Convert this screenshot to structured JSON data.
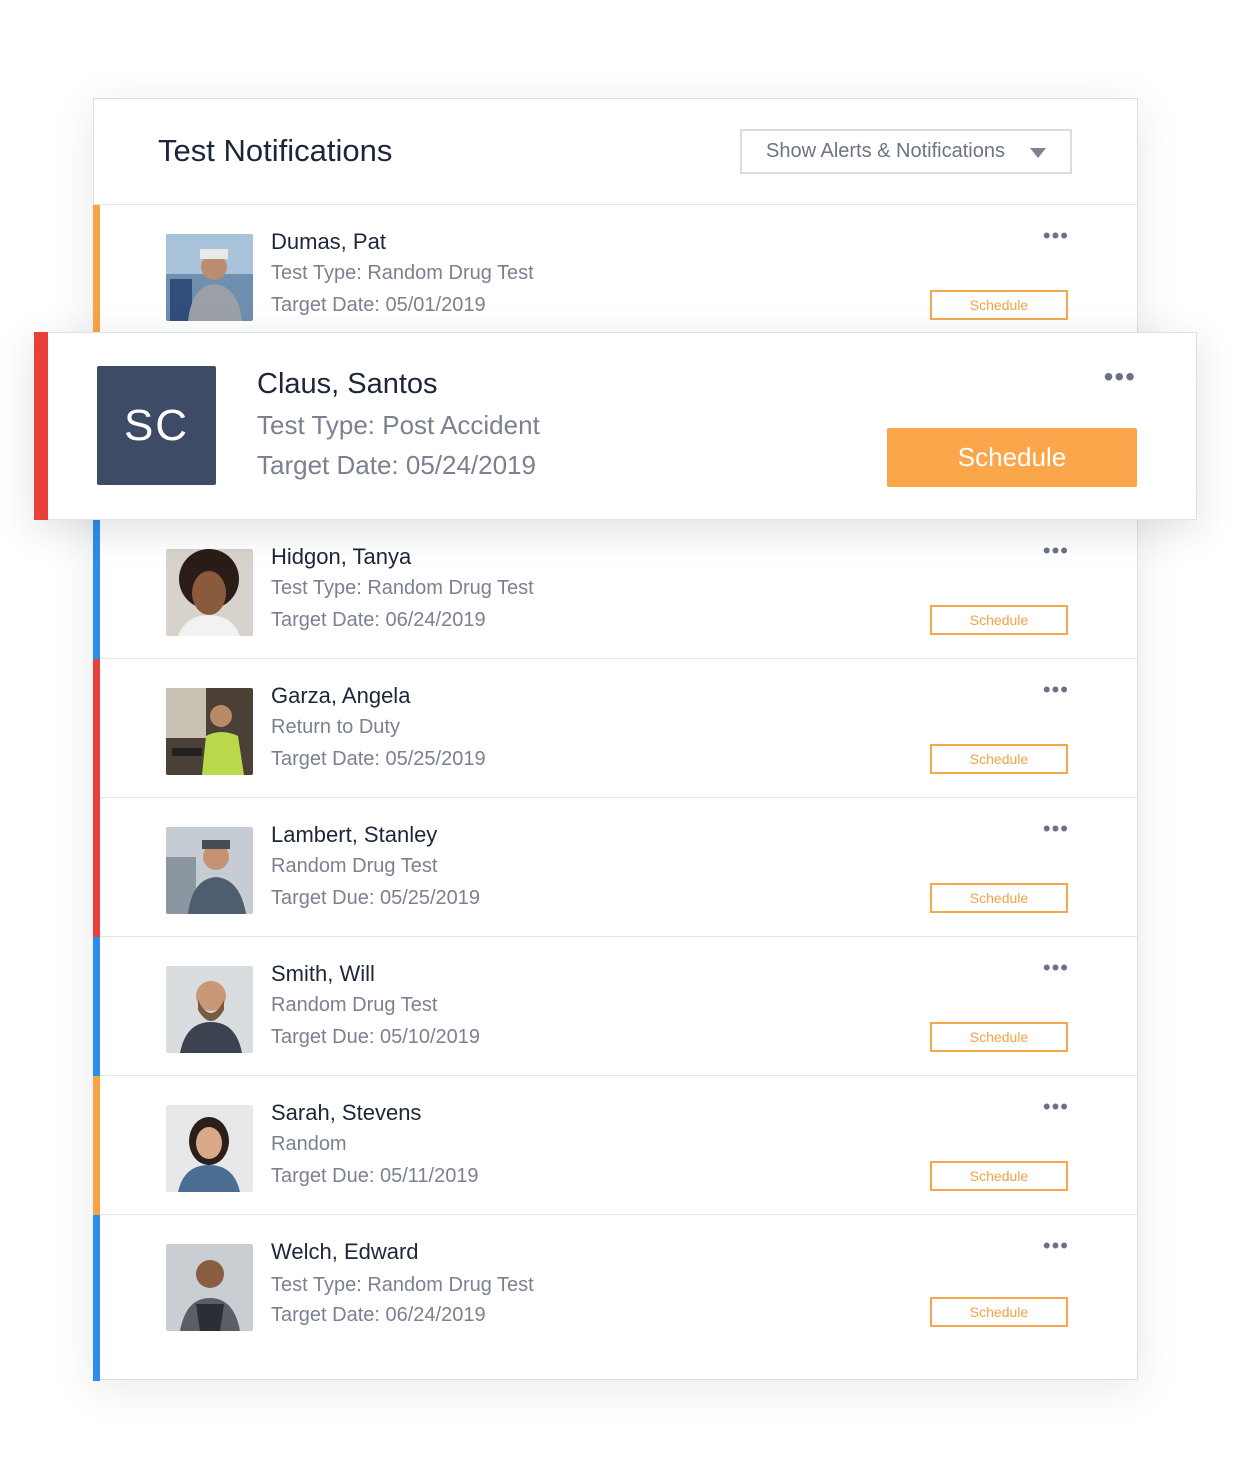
{
  "header": {
    "title": "Test Notifications",
    "filter": {
      "selected": "Show Alerts & Notifications"
    }
  },
  "featured": {
    "initials": "SC",
    "name": "Claus, Santos",
    "line2": "Test Type: Post Accident",
    "line3": "Target Date: 05/24/2019",
    "action": "Schedule",
    "more": "•••",
    "status_color": "#e8413c"
  },
  "rows": [
    {
      "name": "Dumas, Pat",
      "line2": "Test Type: Random Drug Test",
      "line3": "Target Date: 05/01/2019",
      "action": "Schedule",
      "more": "•••",
      "status_color": "#f8a445"
    },
    {
      "name": "Hidgon, Tanya",
      "line2": "Test Type: Random Drug Test",
      "line3": "Target Date: 06/24/2019",
      "action": "Schedule",
      "more": "•••",
      "status_color": "#2d8cf0"
    },
    {
      "name": "Garza, Angela",
      "line2": "Return to Duty",
      "line3": "Target Date: 05/25/2019",
      "action": "Schedule",
      "more": "•••",
      "status_color": "#e8413c"
    },
    {
      "name": "Lambert, Stanley",
      "line2": "Random Drug Test",
      "line3": "Target Due: 05/25/2019",
      "action": "Schedule",
      "more": "•••",
      "status_color": "#e8413c"
    },
    {
      "name": "Smith, Will",
      "line2": "Random Drug Test",
      "line3": "Target Due: 05/10/2019",
      "action": "Schedule",
      "more": "•••",
      "status_color": "#2d8cf0"
    },
    {
      "name": "Sarah, Stevens",
      "line2": "Random",
      "line3": "Target Due: 05/11/2019",
      "action": "Schedule",
      "more": "•••",
      "status_color": "#f8a445"
    },
    {
      "name": "Welch, Edward",
      "line2": "Test Type: Random Drug Test",
      "line3": "Target Date: 06/24/2019",
      "action": "Schedule",
      "more": "•••",
      "status_color": "#2d8cf0"
    }
  ]
}
